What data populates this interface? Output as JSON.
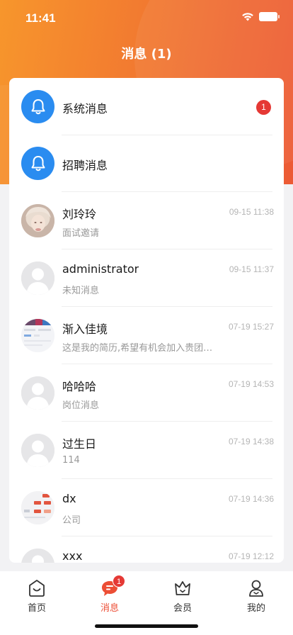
{
  "status_bar": {
    "time": "11:41"
  },
  "header": {
    "title": "消息 (1)"
  },
  "colors": {
    "accent": "#ec4e35",
    "header_start": "#f7962c",
    "header_end": "#ec5a35",
    "bell_blue": "#2a8cf0",
    "badge_red": "#e53935"
  },
  "messages": [
    {
      "name": "系统消息",
      "icon": "bell-icon",
      "badge": "1"
    },
    {
      "name": "招聘消息",
      "icon": "bell-icon"
    },
    {
      "name": "刘玲玲",
      "subtitle": "面试邀请",
      "time": "09-15 11:38",
      "avatar": "photo-avatar"
    },
    {
      "name": "administrator",
      "subtitle": "未知消息",
      "time": "09-15 11:37",
      "avatar": "default-avatar"
    },
    {
      "name": "渐入佳境",
      "subtitle": "这是我的简历,希望有机会加入贵团…",
      "time": "07-19 15:27",
      "avatar": "screenshot-avatar"
    },
    {
      "name": "哈哈哈",
      "subtitle": "岗位消息",
      "time": "07-19 14:53",
      "avatar": "default-avatar"
    },
    {
      "name": "过生日",
      "subtitle": "114",
      "time": "07-19 14:38",
      "avatar": "default-avatar"
    },
    {
      "name": "dx",
      "subtitle": "公司",
      "time": "07-19 14:36",
      "avatar": "screenshot-avatar"
    },
    {
      "name": "xxx",
      "time": "07-19 12:12",
      "avatar": "default-avatar"
    }
  ],
  "tabbar": {
    "items": [
      {
        "label": "首页",
        "icon": "home-icon"
      },
      {
        "label": "消息",
        "icon": "message-icon",
        "badge": "1",
        "active": true
      },
      {
        "label": "会员",
        "icon": "crown-icon"
      },
      {
        "label": "我的",
        "icon": "profile-icon"
      }
    ]
  }
}
